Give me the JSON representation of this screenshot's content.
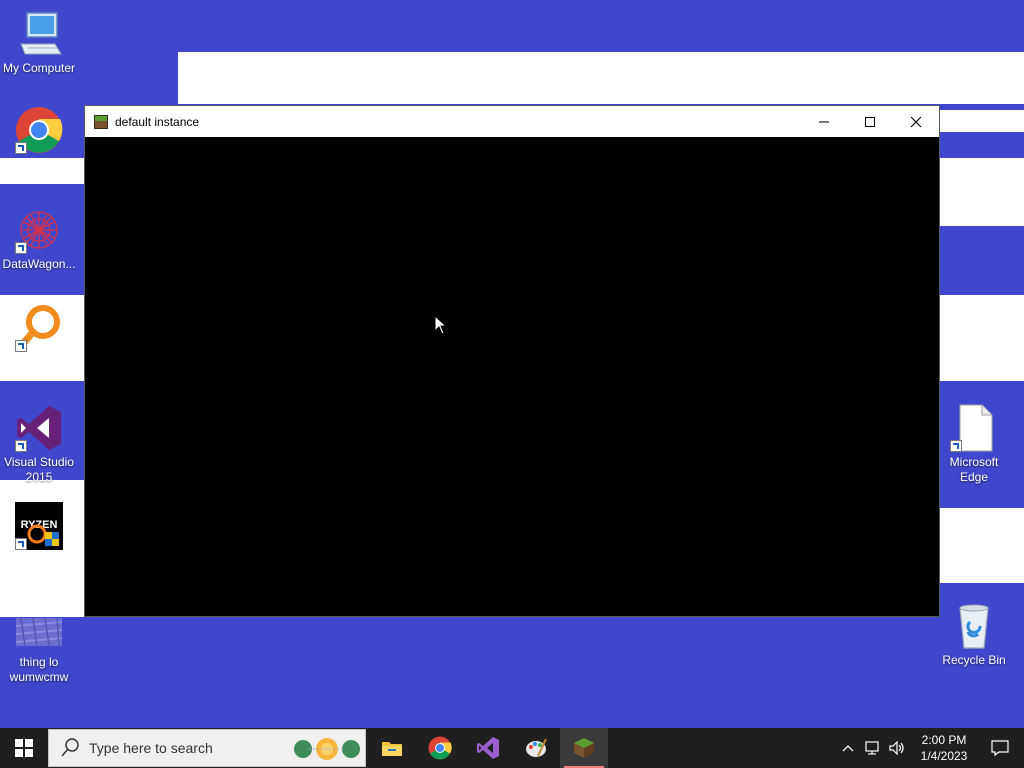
{
  "desktop": {
    "icons": [
      {
        "label": "My Computer",
        "icon": "computer-icon"
      },
      {
        "label": "",
        "icon": "chrome-icon"
      },
      {
        "label": "DataWagon...",
        "icon": "datawagon-icon"
      },
      {
        "label": "",
        "icon": "magnifier-app-icon"
      },
      {
        "label": "Visual Studio 2015",
        "icon": "visual-studio-icon"
      },
      {
        "label": "",
        "icon": "ryzen-master-icon"
      },
      {
        "label": "thing lo wumwcmw",
        "icon": "image-file-icon"
      },
      {
        "label": "Microsoft Edge",
        "icon": "blank-file-icon"
      },
      {
        "label": "Recycle Bin",
        "icon": "recycle-bin-icon"
      }
    ]
  },
  "window": {
    "title": "default instance",
    "icon": "grass-block-icon"
  },
  "taskbar": {
    "search_placeholder": "Type here to search",
    "apps": [
      "file-explorer-icon",
      "chrome-icon",
      "visual-studio-icon",
      "paint-icon",
      "minecraft-icon"
    ],
    "clock_time": "2:00 PM",
    "clock_date": "1/4/2023"
  },
  "colors": {
    "wallpaper": "#3f48cc",
    "taskbar": "#1f1f1f"
  }
}
